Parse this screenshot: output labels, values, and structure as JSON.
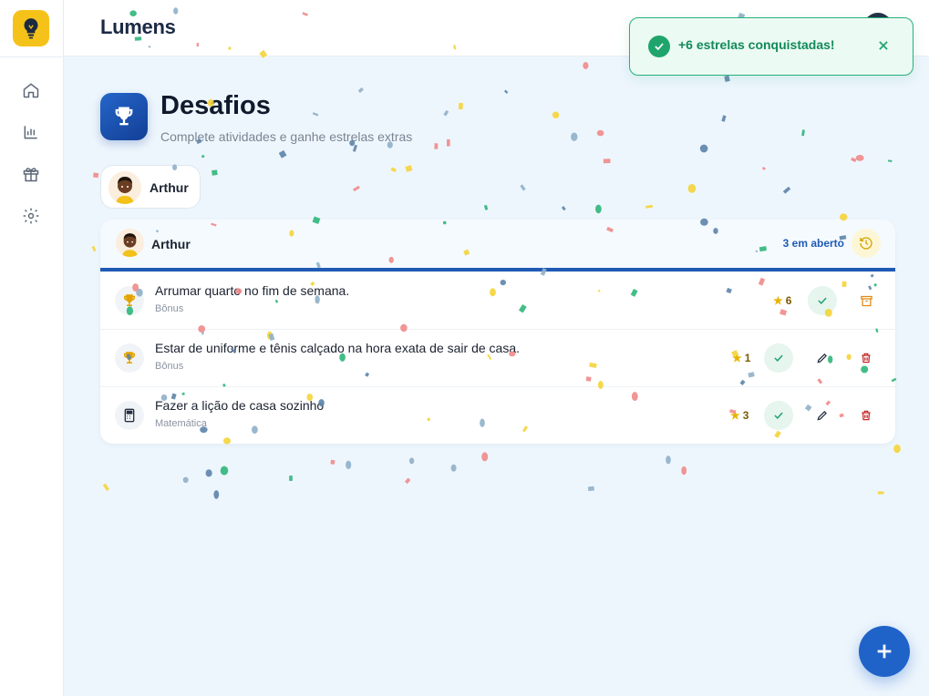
{
  "app": {
    "brand": "Lumens"
  },
  "toast": {
    "message": "+6 estrelas conquistadas!"
  },
  "page": {
    "title": "Desafios",
    "subtitle": "Complete atividades e ganhe estrelas extras"
  },
  "child": {
    "name": "Arthur"
  },
  "card": {
    "name": "Arthur",
    "open_label": "3 em aberto"
  },
  "challenges": [
    {
      "title": "Arrumar quarto no fim de semana.",
      "category": "Bônus",
      "stars": "6",
      "icon": "trophy-icon"
    },
    {
      "title": "Estar de uniforme e tênis calçado na hora exata de sair de casa.",
      "category": "Bônus",
      "stars": "1",
      "icon": "trophy-icon"
    },
    {
      "title": "Fazer a lição de casa sozinho",
      "category": "Matemática",
      "stars": "3",
      "icon": "calculator-icon"
    }
  ],
  "colors": {
    "primary": "#1f5bb5",
    "accent_yellow": "#f5c21a",
    "success": "#1fa56c",
    "danger": "#c62828",
    "archive": "#e08a12"
  }
}
